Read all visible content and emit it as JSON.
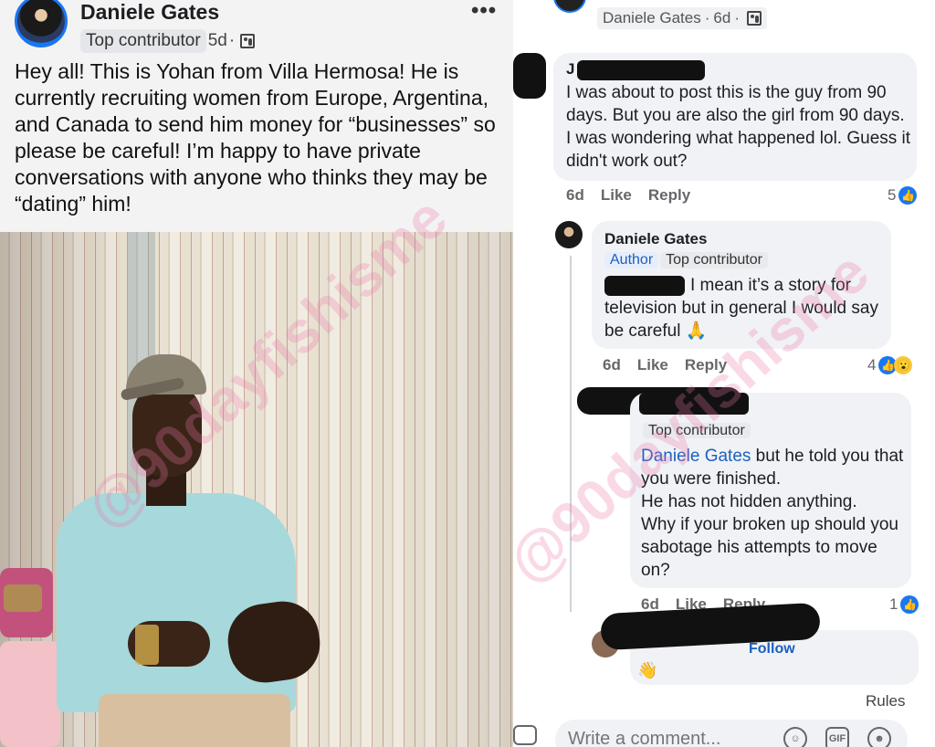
{
  "post": {
    "author": "Daniele Gates",
    "badge": "Top contributor",
    "time": "5d",
    "separator": "·",
    "more": "•••",
    "text": "Hey all! This is Yohan from Villa Hermosa! He is currently recruiting women from Europe, Argentina, and Canada to send him money for “businesses” so please be careful!  I’m happy to have private conversations with anyone who thinks they may be “dating” him!"
  },
  "comments_header": {
    "author": "Daniele Gates",
    "time": "6d",
    "separator": "·"
  },
  "comments": [
    {
      "name_visible": "J",
      "text": "I was about to post this is the guy from 90 days. But you are also the girl from 90 days. I was wondering what happened lol. Guess it didn't work out?",
      "time": "6d",
      "like": "Like",
      "reply": "Reply",
      "reactions": "5"
    },
    {
      "name": "Daniele Gates",
      "author_badge": "Author",
      "contributor_badge": "Top contributor",
      "text": "I mean it’s a story for television but in general I would say be careful 🙏",
      "time": "6d",
      "like": "Like",
      "reply": "Reply",
      "reactions": "4"
    },
    {
      "contributor_badge": "Top contributor",
      "mention": "Daniele Gates",
      "text": " but he told you that you were finished.\nHe has not hidden anything.\nWhy if your broken up should you sabotage his attempts to move on?",
      "time": "6d",
      "like": "Like",
      "reply": "Reply",
      "reactions": "1"
    },
    {
      "follow": "Follow"
    }
  ],
  "footer": {
    "rules": "Rules",
    "composer_placeholder": "Write a comment...",
    "gif_label": "GIF"
  },
  "watermark": "@90dayfishisme",
  "colors": {
    "accent": "#1877f2",
    "bubble": "#f0f2f5",
    "watermark": "#ec78aa"
  }
}
